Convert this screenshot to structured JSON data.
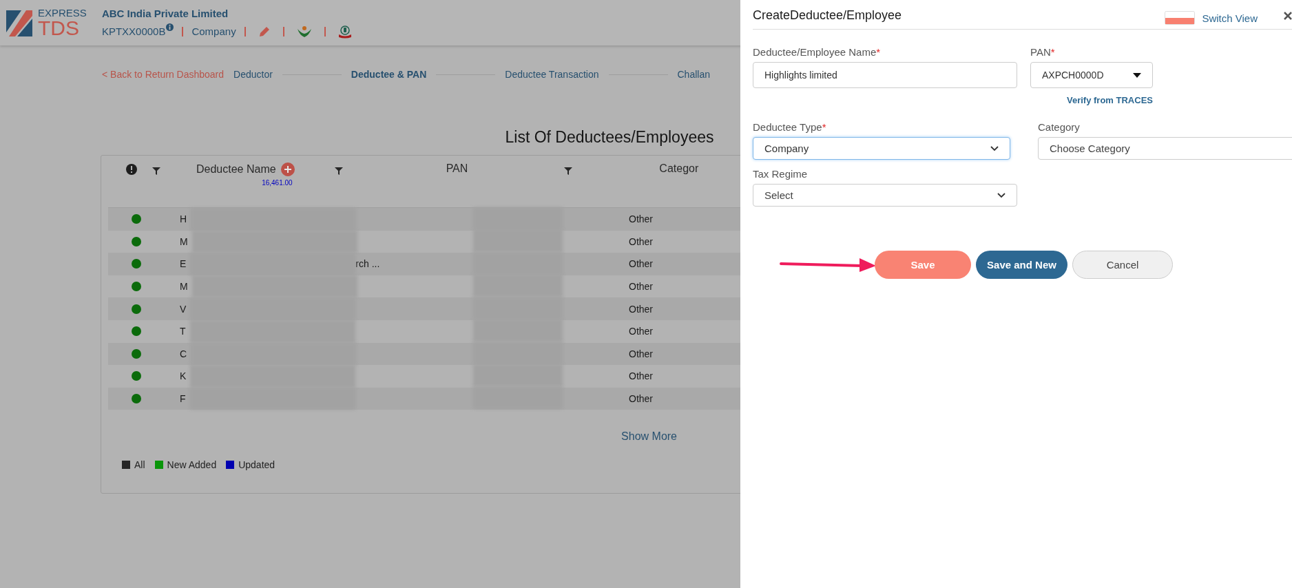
{
  "header": {
    "logo_top": "EXPRESS",
    "logo_bottom": "TDS",
    "company": "ABC India Private Limited",
    "tan": "KPTXX0000B",
    "type": "Company"
  },
  "nav": {
    "back": "< Back to Return Dashboard",
    "steps": [
      {
        "label": "Deductor",
        "selected": false
      },
      {
        "label": "Deductee & PAN",
        "selected": true
      },
      {
        "label": "Deductee Transaction",
        "selected": false
      },
      {
        "label": "Challan",
        "selected": false
      }
    ]
  },
  "title": "List Of Deductees/Employees",
  "table": {
    "columns": [
      "Deductee Name",
      "PAN",
      "Categor"
    ],
    "total": "16,461.00",
    "rows": [
      {
        "color": "#0b6b0b",
        "name": "H",
        "category": "Other"
      },
      {
        "color": "#0b6b0b",
        "name": "M",
        "category": "Other"
      },
      {
        "color": "#0b6b0b",
        "name": "E",
        "name_end": "rch ...",
        "category": "Other"
      },
      {
        "color": "#0b6b0b",
        "name": "M",
        "category": "Other"
      },
      {
        "color": "#0b6b0b",
        "name": "V",
        "category": "Other"
      },
      {
        "color": "#0b6b0b",
        "name": "T",
        "category": "Other"
      },
      {
        "color": "#0b6b0b",
        "name": "C",
        "category": "Other"
      },
      {
        "color": "#0b6b0b",
        "name": "K",
        "category": "Other"
      },
      {
        "color": "#0b6b0b",
        "name": "F",
        "category": "Other"
      }
    ],
    "show_more": "Show More",
    "legend": [
      {
        "label": "All",
        "color": "#262626"
      },
      {
        "label": "New Added",
        "color": "#0a950a"
      },
      {
        "label": "Updated",
        "color": "#0000b0"
      }
    ]
  },
  "panel": {
    "title": "CreateDeductee/Employee",
    "switch_view": "Switch View",
    "fields": [
      {
        "kind": "text",
        "label": "Deductee/Employee Name",
        "mark": "*",
        "value": "Highlights limited",
        "focused": false
      },
      {
        "kind": "pan",
        "label": "PAN",
        "mark": "*",
        "value": "AXPCH0000D",
        "focused": false,
        "link": "Verify from TRACES"
      },
      {
        "kind": "select",
        "label": "Deductee Type",
        "mark": "*",
        "value": "Company",
        "focused": true
      },
      {
        "kind": "select",
        "label": "Category",
        "placeholder": "Choose Category",
        "focused": false
      },
      {
        "kind": "select",
        "label": "Tax Regime",
        "placeholder": "Select",
        "focused": false
      }
    ],
    "buttons": [
      {
        "label": "Save",
        "kind": "primary"
      },
      {
        "label": "Save and New",
        "kind": "secondary"
      },
      {
        "label": "Cancel",
        "kind": "cancel"
      }
    ]
  }
}
